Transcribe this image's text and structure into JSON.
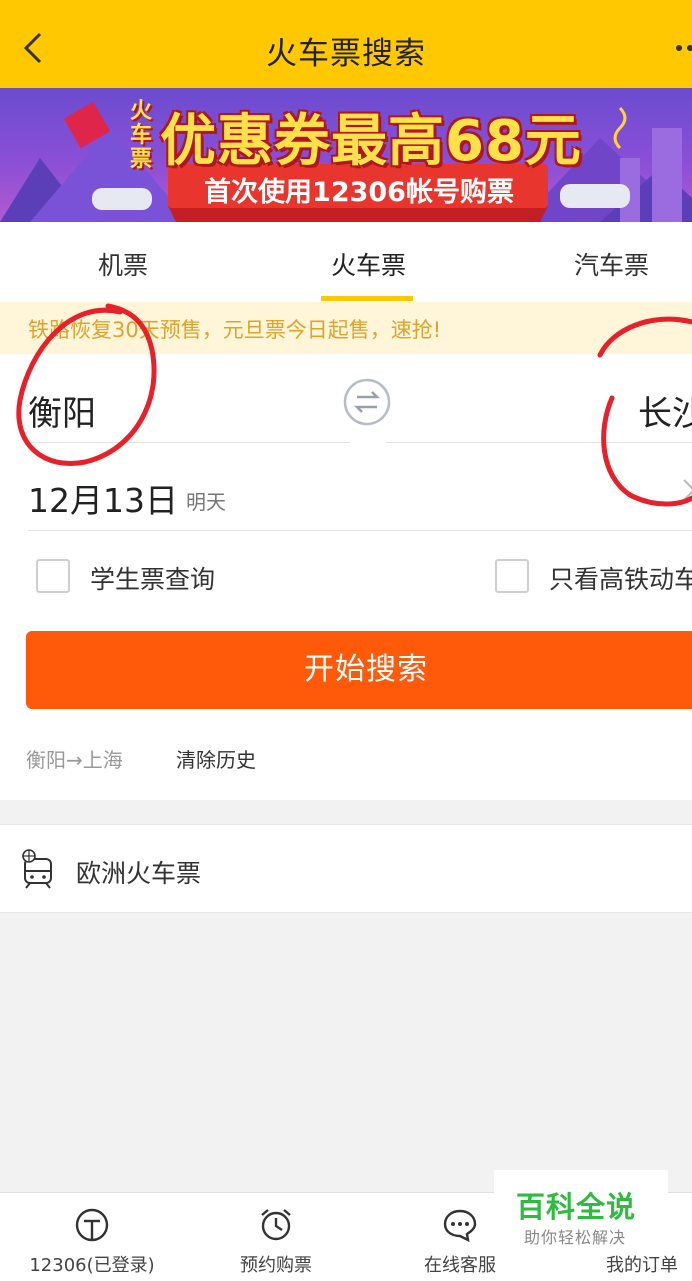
{
  "header": {
    "title": "火车票搜索"
  },
  "banner": {
    "side_text": "火车票",
    "main_text": "优惠券最高68元",
    "sub_text": "首次使用12306帐号购票"
  },
  "tabs": [
    {
      "label": "机票",
      "active": false
    },
    {
      "label": "火车票",
      "active": true
    },
    {
      "label": "汽车票",
      "active": false
    }
  ],
  "notice": "铁路恢复30天预售，元旦票今日起售，速抢!",
  "form": {
    "from_city": "衡阳",
    "to_city": "长沙",
    "date": "12月13日",
    "date_note": "明天",
    "student_label": "学生票查询",
    "highspeed_label": "只看高铁动车",
    "search_button": "开始搜索",
    "history_item": "衡阳→上海",
    "clear_history": "清除历史"
  },
  "euro": {
    "label": "欧洲火车票"
  },
  "tabbar": [
    {
      "label": "12306(已登录)",
      "icon": "train-logo-icon"
    },
    {
      "label": "预约购票",
      "icon": "alarm-clock-icon"
    },
    {
      "label": "在线客服",
      "icon": "chat-bubble-icon"
    },
    {
      "label": "我的订单",
      "icon": "order-icon"
    }
  ],
  "watermark": {
    "main": "百科全说",
    "sub": "助你轻松解决"
  },
  "colors": {
    "header": "#ffc800",
    "search_button": "#ff5a0a",
    "notice_text": "#e0a22a",
    "annotation": "#e8202a"
  }
}
